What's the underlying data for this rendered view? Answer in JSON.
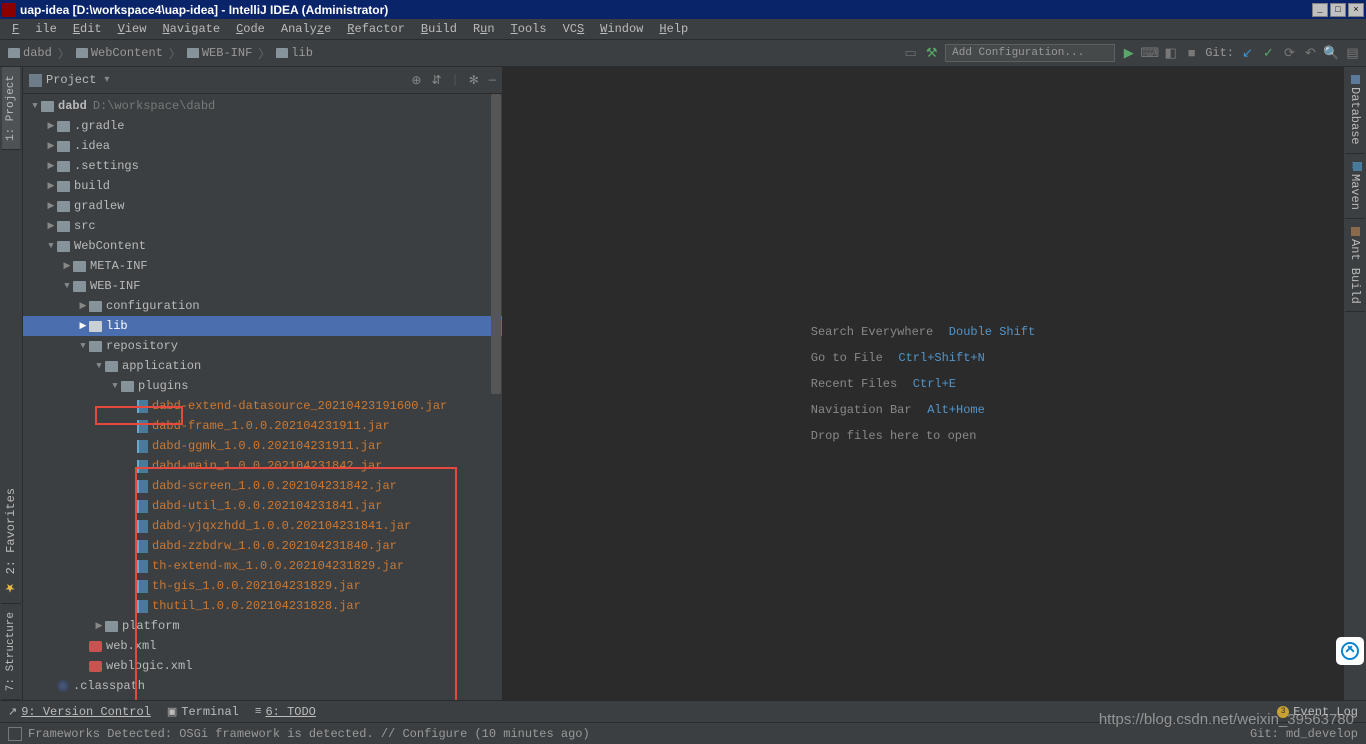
{
  "titlebar": {
    "text": "uap-idea [D:\\workspace4\\uap-idea] - IntelliJ IDEA (Administrator)"
  },
  "menu": {
    "file": "File",
    "edit": "Edit",
    "view": "View",
    "navigate": "Navigate",
    "code": "Code",
    "analyze": "Analyze",
    "refactor": "Refactor",
    "build": "Build",
    "run": "Run",
    "tools": "Tools",
    "vcs": "VCS",
    "window": "Window",
    "help": "Help"
  },
  "breadcrumbs": [
    "dabd",
    "WebContent",
    "WEB-INF",
    "lib"
  ],
  "run_config": {
    "placeholder": "Add Configuration..."
  },
  "git_label": "Git:",
  "panel": {
    "title": "Project",
    "icons": {
      "target": "⊕",
      "collapse": "⇵",
      "settings": "✻",
      "hide": "—"
    }
  },
  "tree": {
    "root": {
      "name": "dabd",
      "path": "D:\\workspace\\dabd"
    },
    "folders_level1": [
      ".gradle",
      ".idea",
      ".settings",
      "build",
      "gradlew",
      "src"
    ],
    "webcontent": "WebContent",
    "meta_inf": "META-INF",
    "web_inf": "WEB-INF",
    "configuration": "configuration",
    "lib": "lib",
    "repository": "repository",
    "application": "application",
    "plugins": "plugins",
    "jars": [
      "dabd-extend-datasource_20210423191600.jar",
      "dabd-frame_1.0.0.202104231911.jar",
      "dabd-ggmk_1.0.0.202104231911.jar",
      "dabd-main_1.0.0.202104231842.jar",
      "dabd-screen_1.0.0.202104231842.jar",
      "dabd-util_1.0.0.202104231841.jar",
      "dabd-yjqxzhdd_1.0.0.202104231841.jar",
      "dabd-zzbdrw_1.0.0.202104231840.jar",
      "th-extend-mx_1.0.0.202104231829.jar",
      "th-gis_1.0.0.202104231829.jar",
      "thutil_1.0.0.202104231828.jar"
    ],
    "platform": "platform",
    "web_xml": "web.xml",
    "weblogic_xml": "weblogic.xml",
    "classpath": ".classpath"
  },
  "welcome": {
    "search": "Search Everywhere",
    "search_key": "Double Shift",
    "goto": "Go to File",
    "goto_key": "Ctrl+Shift+N",
    "recent": "Recent Files",
    "recent_key": "Ctrl+E",
    "nav": "Navigation Bar",
    "nav_key": "Alt+Home",
    "drop": "Drop files here to open"
  },
  "left_tabs": {
    "project": "1: Project",
    "favorites": "2: Favorites",
    "structure": "7: Structure"
  },
  "right_tabs": {
    "database": "Database",
    "maven": "Maven",
    "ant": "Ant Build"
  },
  "bottom_tabs": {
    "vcs": "9: Version Control",
    "terminal": "Terminal",
    "todo": "6: TODO"
  },
  "event_log": {
    "count": "3",
    "label": "Event Log"
  },
  "statusbar": {
    "msg": "Frameworks Detected: OSGi framework is detected. // Configure (10 minutes ago)",
    "git": "Git: md_develop"
  },
  "watermark": "https://blog.csdn.net/weixin_39563780"
}
